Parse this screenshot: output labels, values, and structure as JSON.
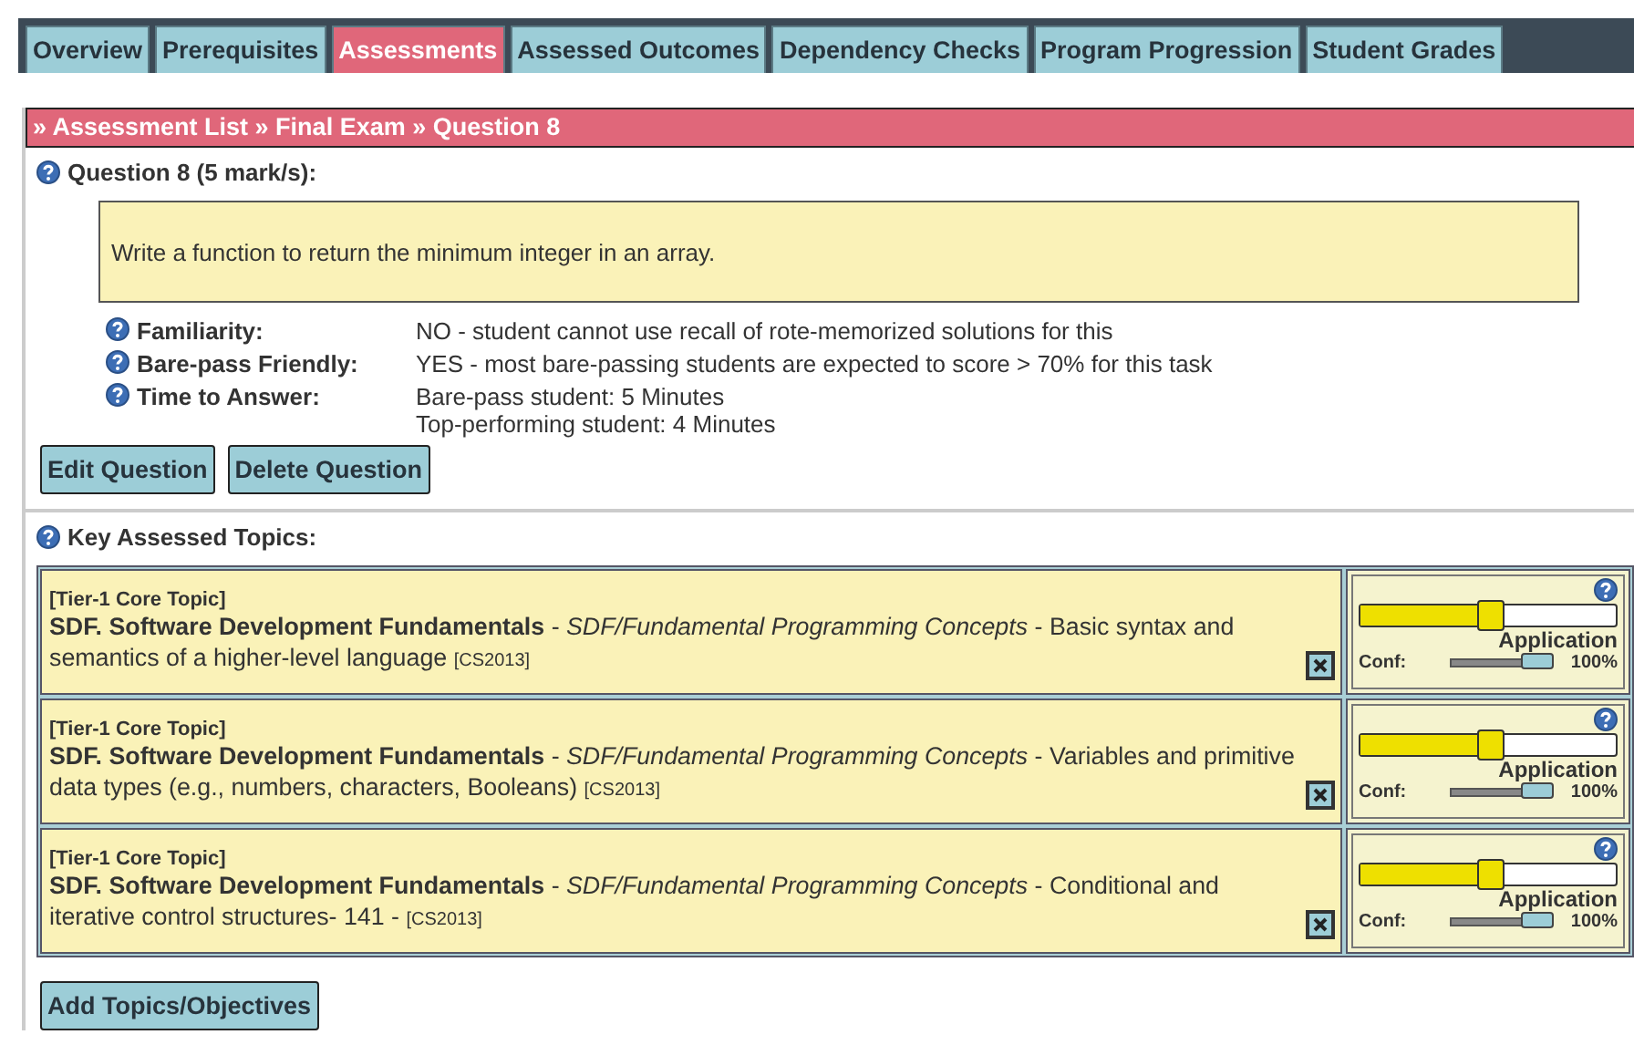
{
  "tabs": [
    {
      "label": "Overview",
      "selected": false
    },
    {
      "label": "Prerequisites",
      "selected": false
    },
    {
      "label": "Assessments",
      "selected": true
    },
    {
      "label": "Assessed Outcomes",
      "selected": false
    },
    {
      "label": "Dependency Checks",
      "selected": false
    },
    {
      "label": "Program Progression",
      "selected": false
    },
    {
      "label": "Student Grades",
      "selected": false
    }
  ],
  "breadcrumb": "» Assessment List » Final Exam » Question 8",
  "question_heading": "Question 8 (5 mark/s):",
  "question_text": "Write a function to return the minimum integer in an array.",
  "properties": [
    {
      "label": "Familiarity:",
      "values": [
        "NO - student cannot use recall of rote-memorized solutions for this"
      ]
    },
    {
      "label": "Bare-pass Friendly:",
      "values": [
        "YES - most bare-passing students are expected to score > 70% for this task"
      ]
    },
    {
      "label": "Time to Answer:",
      "values": [
        "Bare-pass student: 5 Minutes",
        "Top-performing student: 4 Minutes"
      ]
    }
  ],
  "buttons": [
    "Edit Question",
    "Delete Question"
  ],
  "topics_heading": "Key Assessed Topics:",
  "topics": [
    {
      "tier": "[Tier-1 Core Topic]",
      "text": "**SDF. Software Development Fundamentals** - *SDF/Fundamental Programming Concepts* - Basic syntax and semantics of a higher-level language",
      "source": "[CS2013]",
      "level": 0.51,
      "level_label": "Application",
      "confidence": {
        "label": "Conf:",
        "level": 1,
        "reading": "100%"
      }
    },
    {
      "tier": "[Tier-1 Core Topic]",
      "text": "**SDF. Software Development Fundamentals** - *SDF/Fundamental Programming Concepts* - Variables and primitive data types (e.g., numbers, characters, Booleans)",
      "source": "[CS2013]",
      "level": 0.51,
      "level_label": "Application",
      "confidence": {
        "label": "Conf:",
        "level": 1,
        "reading": "100%"
      }
    },
    {
      "tier": "[Tier-1 Core Topic]",
      "text": "**SDF. Software Development Fundamentals** - *SDF/Fundamental Programming Concepts* - Conditional and iterative control structures- 141 -",
      "source": "[CS2013]",
      "level": 0.51,
      "level_label": "Application",
      "confidence": {
        "label": "Conf:",
        "level": 1,
        "reading": "100%"
      }
    }
  ],
  "add_button": "Add Topics/Objectives"
}
